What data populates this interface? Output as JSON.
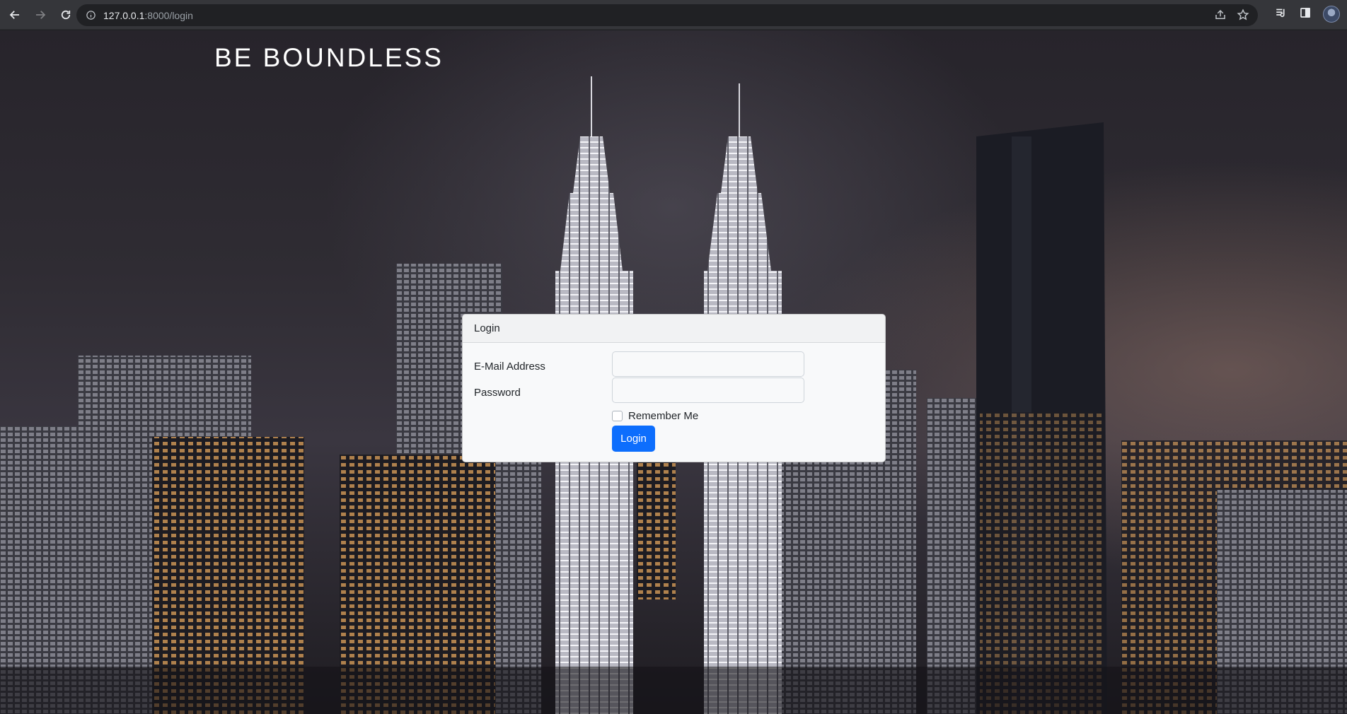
{
  "browser": {
    "url_host": "127.0.0.1",
    "url_rest": ":8000/login",
    "icons": [
      "back-arrow-icon",
      "forward-arrow-icon",
      "reload-icon",
      "info-icon",
      "share-icon",
      "star-icon",
      "tab-search-icon",
      "side-panel-icon",
      "profile-avatar"
    ]
  },
  "page": {
    "brand": "BE BOUNDLESS"
  },
  "login_card": {
    "header": "Login",
    "email_label": "E-Mail Address",
    "email_value": "",
    "password_label": "Password",
    "password_value": "",
    "remember_label": "Remember Me",
    "remember_checked": false,
    "submit_label": "Login"
  },
  "colors": {
    "primary": "#0d6efd",
    "card_bg": "#f8f9fa",
    "chrome_bg": "#35363a"
  }
}
